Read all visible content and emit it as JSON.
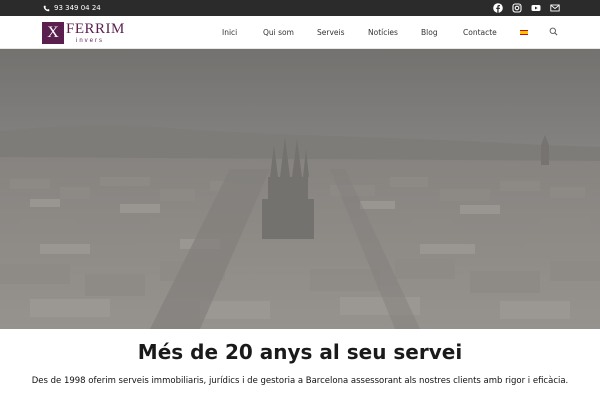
{
  "topbar": {
    "phone": "93 349 04 24",
    "icons": [
      "facebook-icon",
      "instagram-icon",
      "youtube-icon",
      "mail-icon"
    ]
  },
  "header": {
    "logo_mark": "X",
    "logo_name": "FERRIM",
    "logo_sub": "invers",
    "nav": [
      "Inici",
      "Qui som",
      "Serveis",
      "Notícies",
      "Blog",
      "Contacte"
    ],
    "language_flag": "spanish-flag-icon",
    "search_icon": "search-icon"
  },
  "hero": {
    "image": "barcelona-city-panorama",
    "overlay_color": "#8a8885"
  },
  "intro": {
    "headline": "Més de 20 anys al seu servei",
    "text": "Des de 1998 oferim serveis immobiliaris, jurídics i de gestoria a Barcelona assessorant als nostres clients amb rigor i eficàcia."
  },
  "colors": {
    "brand": "#5a1f4e",
    "topbar": "#2b2b2b"
  }
}
